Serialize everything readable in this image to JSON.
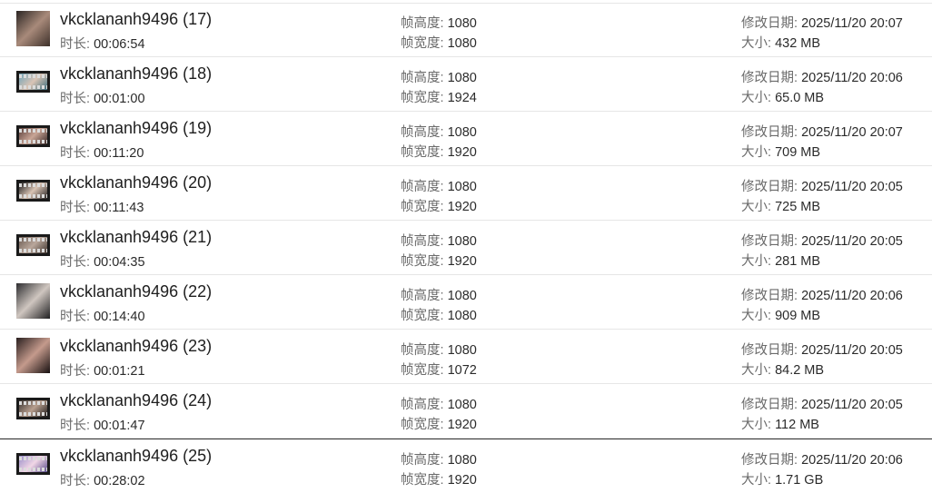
{
  "labels": {
    "duration": "时长: ",
    "height": "帧高度: ",
    "width": "帧宽度: ",
    "modified": "修改日期: ",
    "size": "大小: "
  },
  "files": [
    {
      "name": "vkcklananh9496 (17)",
      "duration": "00:06:54",
      "height": "1080",
      "width": "1080",
      "modified": "2025/11/20 20:07",
      "size": "432 MB",
      "thumb_colors": [
        "#2b2523",
        "#a88a7a",
        "#3d302a"
      ]
    },
    {
      "name": "vkcklananh9496 (18)",
      "duration": "00:01:00",
      "height": "1080",
      "width": "1924",
      "modified": "2025/11/20 20:06",
      "size": "65.0 MB",
      "thumb_colors": [
        "#6fa3b8",
        "#d9c4b5",
        "#3c6d7d"
      ]
    },
    {
      "name": "vkcklananh9496 (19)",
      "duration": "00:11:20",
      "height": "1080",
      "width": "1920",
      "modified": "2025/11/20 20:07",
      "size": "709 MB",
      "thumb_colors": [
        "#5a3e3a",
        "#c9a596",
        "#3a2a28"
      ]
    },
    {
      "name": "vkcklananh9496 (20)",
      "duration": "00:11:43",
      "height": "1080",
      "width": "1920",
      "modified": "2025/11/20 20:05",
      "size": "725 MB",
      "thumb_colors": [
        "#1a1a1c",
        "#d8c3b4",
        "#2a2626"
      ]
    },
    {
      "name": "vkcklananh9496 (21)",
      "duration": "00:04:35",
      "height": "1080",
      "width": "1920",
      "modified": "2025/11/20 20:05",
      "size": "281 MB",
      "thumb_colors": [
        "#6b5b52",
        "#b9a79b",
        "#40352f"
      ]
    },
    {
      "name": "vkcklananh9496 (22)",
      "duration": "00:14:40",
      "height": "1080",
      "width": "1080",
      "modified": "2025/11/20 20:06",
      "size": "909 MB",
      "thumb_colors": [
        "#2d2d30",
        "#cfc6c0",
        "#1e1e20"
      ]
    },
    {
      "name": "vkcklananh9496 (23)",
      "duration": "00:01:21",
      "height": "1080",
      "width": "1072",
      "modified": "2025/11/20 20:05",
      "size": "84.2 MB",
      "thumb_colors": [
        "#2a1f1f",
        "#c49a8c",
        "#160f0f"
      ]
    },
    {
      "name": "vkcklananh9496 (24)",
      "duration": "00:01:47",
      "height": "1080",
      "width": "1920",
      "modified": "2025/11/20 20:05",
      "size": "112 MB",
      "thumb_colors": [
        "#3a3432",
        "#b79e8e",
        "#1f1b1a"
      ]
    },
    {
      "name": "vkcklananh9496 (25)",
      "duration": "00:28:02",
      "height": "1080",
      "width": "1920",
      "modified": "2025/11/20 20:06",
      "size": "1.71 GB",
      "thumb_colors": [
        "#9a8fc8",
        "#f1d6e6",
        "#5a4d8c"
      ]
    }
  ]
}
